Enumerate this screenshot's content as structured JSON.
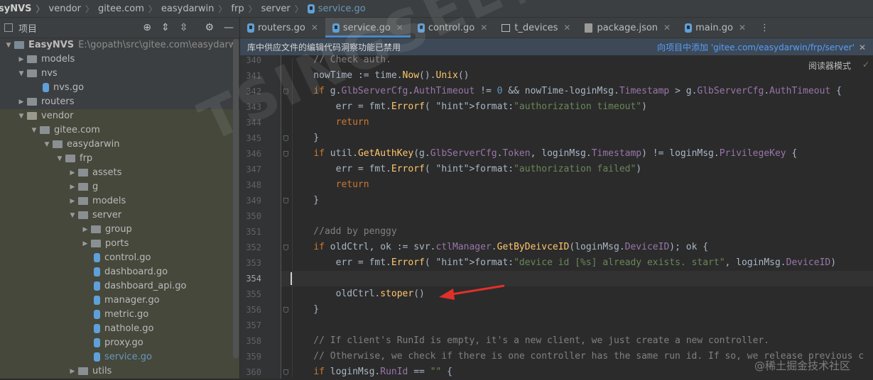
{
  "breadcrumb": [
    "syNVS",
    "vendor",
    "gitee.com",
    "easydarwin",
    "frp",
    "server",
    "service.go"
  ],
  "project_panel": {
    "title": "项目",
    "tree": [
      {
        "label": "EasyNVS",
        "path": "E:\\gopath\\src\\gitee.com\\easydarwin\\Easy",
        "depth": 0,
        "kind": "folder",
        "expanded": true
      },
      {
        "label": "models",
        "depth": 1,
        "kind": "folder",
        "expanded": false
      },
      {
        "label": "nvs",
        "depth": 1,
        "kind": "folder",
        "expanded": true
      },
      {
        "label": "nvs.go",
        "depth": 2,
        "kind": "go"
      },
      {
        "label": "routers",
        "depth": 1,
        "kind": "folder",
        "expanded": false
      },
      {
        "label": "vendor",
        "depth": 1,
        "kind": "vendor",
        "expanded": true
      },
      {
        "label": "gitee.com",
        "depth": 2,
        "kind": "folder",
        "expanded": true
      },
      {
        "label": "easydarwin",
        "depth": 3,
        "kind": "folder",
        "expanded": true
      },
      {
        "label": "frp",
        "depth": 4,
        "kind": "folder",
        "expanded": true
      },
      {
        "label": "assets",
        "depth": 5,
        "kind": "folder",
        "expanded": false
      },
      {
        "label": "g",
        "depth": 5,
        "kind": "folder",
        "expanded": false
      },
      {
        "label": "models",
        "depth": 5,
        "kind": "folder",
        "expanded": false
      },
      {
        "label": "server",
        "depth": 5,
        "kind": "folder",
        "expanded": true
      },
      {
        "label": "group",
        "depth": 6,
        "kind": "folder",
        "expanded": false
      },
      {
        "label": "ports",
        "depth": 6,
        "kind": "folder",
        "expanded": false
      },
      {
        "label": "control.go",
        "depth": 6,
        "kind": "go"
      },
      {
        "label": "dashboard.go",
        "depth": 6,
        "kind": "go"
      },
      {
        "label": "dashboard_api.go",
        "depth": 6,
        "kind": "go"
      },
      {
        "label": "manager.go",
        "depth": 6,
        "kind": "go"
      },
      {
        "label": "metric.go",
        "depth": 6,
        "kind": "go"
      },
      {
        "label": "nathole.go",
        "depth": 6,
        "kind": "go"
      },
      {
        "label": "proxy.go",
        "depth": 6,
        "kind": "go"
      },
      {
        "label": "service.go",
        "depth": 6,
        "kind": "go",
        "current": true
      },
      {
        "label": "utils",
        "depth": 5,
        "kind": "folder",
        "expanded": false
      }
    ]
  },
  "tabs": [
    {
      "label": "routers.go",
      "icon": "go-file-icon",
      "active": false
    },
    {
      "label": "service.go",
      "icon": "go-file-icon",
      "active": true
    },
    {
      "label": "control.go",
      "icon": "go-file-icon",
      "active": false
    },
    {
      "label": "t_devices",
      "icon": "table-icon",
      "active": false
    },
    {
      "label": "package.json",
      "icon": "json-file-icon",
      "active": false
    },
    {
      "label": "main.go",
      "icon": "go-file-icon",
      "active": false
    }
  ],
  "notice": {
    "message": "库中供应文件的编辑代码洞察功能已禁用",
    "action": "向项目中添加 'gitee.com/easydarwin/frp/server'"
  },
  "reader_mode": "阅读器模式",
  "line_numbers": [
    "340",
    "341",
    "342",
    "343",
    "344",
    "345",
    "346",
    "347",
    "348",
    "349",
    "350",
    "351",
    "352",
    "353",
    "354",
    "355",
    "356",
    "357",
    "358",
    "359",
    "360"
  ],
  "code_lines": [
    "    // Check auth.",
    "    nowTime := time.Now().Unix()",
    "    if g.GlbServerCfg.AuthTimeout != 0 && nowTime-loginMsg.Timestamp > g.GlbServerCfg.AuthTimeout {",
    "        err = fmt.Errorf( format: \"authorization timeout\")",
    "        return",
    "    }",
    "    if util.GetAuthKey(g.GlbServerCfg.Token, loginMsg.Timestamp) != loginMsg.PrivilegeKey {",
    "        err = fmt.Errorf( format: \"authorization failed\")",
    "        return",
    "    }",
    "",
    "    //add by penggy",
    "    if oldCtrl, ok := svr.ctlManager.GetByDeivceID(loginMsg.DeviceID); ok {",
    "        err = fmt.Errorf( format: \"device id [%s] already exists. start\", loginMsg.DeviceID)",
    "",
    "        oldCtrl.stoper()",
    "    }",
    "",
    "    // If client's RunId is empty, it's a new client, we just create a new controller.",
    "    // Otherwise, we check if there is one controller has the same run id. If so, we release previous c",
    "    if loginMsg.RunId == \"\" {"
  ],
  "watermark": "TSINGSEE青犀视频",
  "credit": "@稀土掘金技术社区"
}
